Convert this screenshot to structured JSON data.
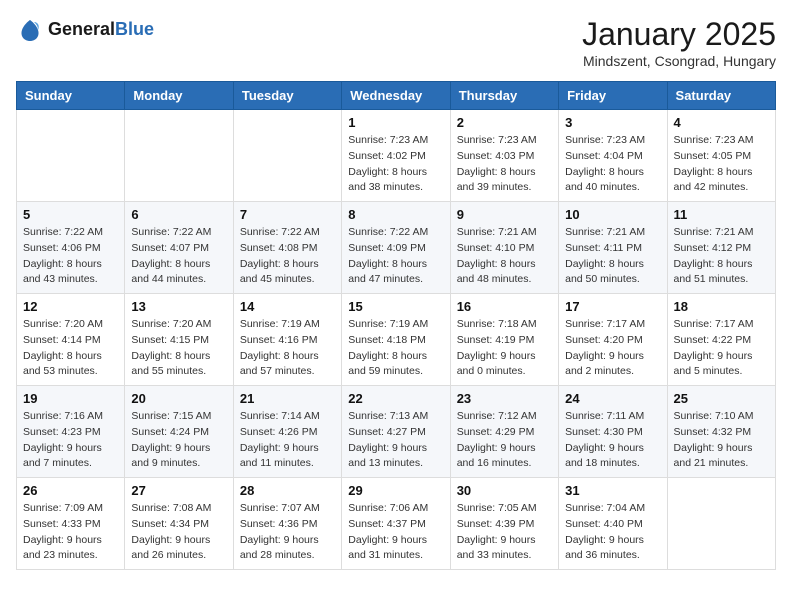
{
  "header": {
    "logo_general": "General",
    "logo_blue": "Blue",
    "month_title": "January 2025",
    "location": "Mindszent, Csongrad, Hungary"
  },
  "weekdays": [
    "Sunday",
    "Monday",
    "Tuesday",
    "Wednesday",
    "Thursday",
    "Friday",
    "Saturday"
  ],
  "weeks": [
    [
      {
        "day": "",
        "info": ""
      },
      {
        "day": "",
        "info": ""
      },
      {
        "day": "",
        "info": ""
      },
      {
        "day": "1",
        "info": "Sunrise: 7:23 AM\nSunset: 4:02 PM\nDaylight: 8 hours\nand 38 minutes."
      },
      {
        "day": "2",
        "info": "Sunrise: 7:23 AM\nSunset: 4:03 PM\nDaylight: 8 hours\nand 39 minutes."
      },
      {
        "day": "3",
        "info": "Sunrise: 7:23 AM\nSunset: 4:04 PM\nDaylight: 8 hours\nand 40 minutes."
      },
      {
        "day": "4",
        "info": "Sunrise: 7:23 AM\nSunset: 4:05 PM\nDaylight: 8 hours\nand 42 minutes."
      }
    ],
    [
      {
        "day": "5",
        "info": "Sunrise: 7:22 AM\nSunset: 4:06 PM\nDaylight: 8 hours\nand 43 minutes."
      },
      {
        "day": "6",
        "info": "Sunrise: 7:22 AM\nSunset: 4:07 PM\nDaylight: 8 hours\nand 44 minutes."
      },
      {
        "day": "7",
        "info": "Sunrise: 7:22 AM\nSunset: 4:08 PM\nDaylight: 8 hours\nand 45 minutes."
      },
      {
        "day": "8",
        "info": "Sunrise: 7:22 AM\nSunset: 4:09 PM\nDaylight: 8 hours\nand 47 minutes."
      },
      {
        "day": "9",
        "info": "Sunrise: 7:21 AM\nSunset: 4:10 PM\nDaylight: 8 hours\nand 48 minutes."
      },
      {
        "day": "10",
        "info": "Sunrise: 7:21 AM\nSunset: 4:11 PM\nDaylight: 8 hours\nand 50 minutes."
      },
      {
        "day": "11",
        "info": "Sunrise: 7:21 AM\nSunset: 4:12 PM\nDaylight: 8 hours\nand 51 minutes."
      }
    ],
    [
      {
        "day": "12",
        "info": "Sunrise: 7:20 AM\nSunset: 4:14 PM\nDaylight: 8 hours\nand 53 minutes."
      },
      {
        "day": "13",
        "info": "Sunrise: 7:20 AM\nSunset: 4:15 PM\nDaylight: 8 hours\nand 55 minutes."
      },
      {
        "day": "14",
        "info": "Sunrise: 7:19 AM\nSunset: 4:16 PM\nDaylight: 8 hours\nand 57 minutes."
      },
      {
        "day": "15",
        "info": "Sunrise: 7:19 AM\nSunset: 4:18 PM\nDaylight: 8 hours\nand 59 minutes."
      },
      {
        "day": "16",
        "info": "Sunrise: 7:18 AM\nSunset: 4:19 PM\nDaylight: 9 hours\nand 0 minutes."
      },
      {
        "day": "17",
        "info": "Sunrise: 7:17 AM\nSunset: 4:20 PM\nDaylight: 9 hours\nand 2 minutes."
      },
      {
        "day": "18",
        "info": "Sunrise: 7:17 AM\nSunset: 4:22 PM\nDaylight: 9 hours\nand 5 minutes."
      }
    ],
    [
      {
        "day": "19",
        "info": "Sunrise: 7:16 AM\nSunset: 4:23 PM\nDaylight: 9 hours\nand 7 minutes."
      },
      {
        "day": "20",
        "info": "Sunrise: 7:15 AM\nSunset: 4:24 PM\nDaylight: 9 hours\nand 9 minutes."
      },
      {
        "day": "21",
        "info": "Sunrise: 7:14 AM\nSunset: 4:26 PM\nDaylight: 9 hours\nand 11 minutes."
      },
      {
        "day": "22",
        "info": "Sunrise: 7:13 AM\nSunset: 4:27 PM\nDaylight: 9 hours\nand 13 minutes."
      },
      {
        "day": "23",
        "info": "Sunrise: 7:12 AM\nSunset: 4:29 PM\nDaylight: 9 hours\nand 16 minutes."
      },
      {
        "day": "24",
        "info": "Sunrise: 7:11 AM\nSunset: 4:30 PM\nDaylight: 9 hours\nand 18 minutes."
      },
      {
        "day": "25",
        "info": "Sunrise: 7:10 AM\nSunset: 4:32 PM\nDaylight: 9 hours\nand 21 minutes."
      }
    ],
    [
      {
        "day": "26",
        "info": "Sunrise: 7:09 AM\nSunset: 4:33 PM\nDaylight: 9 hours\nand 23 minutes."
      },
      {
        "day": "27",
        "info": "Sunrise: 7:08 AM\nSunset: 4:34 PM\nDaylight: 9 hours\nand 26 minutes."
      },
      {
        "day": "28",
        "info": "Sunrise: 7:07 AM\nSunset: 4:36 PM\nDaylight: 9 hours\nand 28 minutes."
      },
      {
        "day": "29",
        "info": "Sunrise: 7:06 AM\nSunset: 4:37 PM\nDaylight: 9 hours\nand 31 minutes."
      },
      {
        "day": "30",
        "info": "Sunrise: 7:05 AM\nSunset: 4:39 PM\nDaylight: 9 hours\nand 33 minutes."
      },
      {
        "day": "31",
        "info": "Sunrise: 7:04 AM\nSunset: 4:40 PM\nDaylight: 9 hours\nand 36 minutes."
      },
      {
        "day": "",
        "info": ""
      }
    ]
  ]
}
